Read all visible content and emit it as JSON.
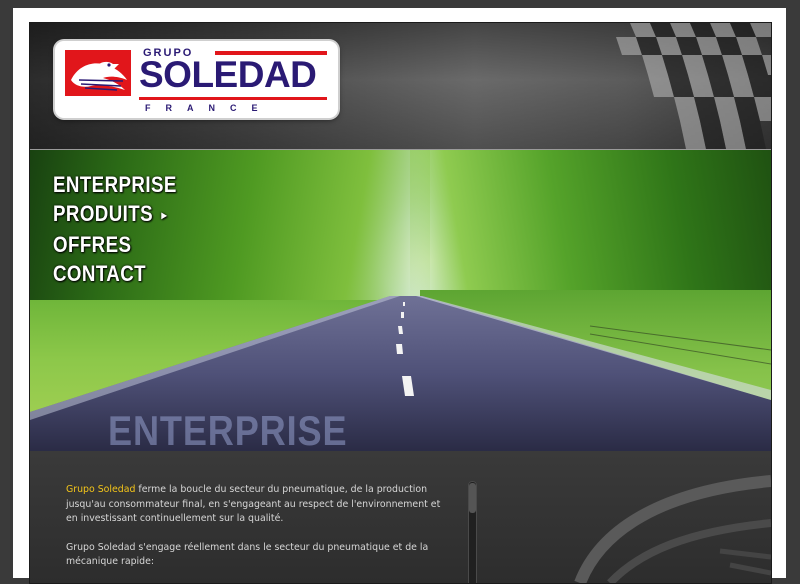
{
  "logo": {
    "grupo": "GRUPO",
    "name": "SOLEDAD",
    "country": "FRANCE",
    "colors": {
      "brand_blue": "#2a1a74",
      "brand_red": "#e1161b"
    }
  },
  "nav": {
    "items": [
      {
        "label": "ENTERPRISE"
      },
      {
        "label": "PRODUITS",
        "arrow": "▸"
      },
      {
        "label": "OFFRES"
      },
      {
        "label": "CONTACT"
      }
    ]
  },
  "hero": {
    "section_title": "ENTERPRISE"
  },
  "content": {
    "p1_highlight": "Grupo Soledad",
    "p1_rest": " ferme la boucle du secteur du pneumatique, de la production jusqu'au consommateur final, en s'engageant au respect de l'environnement et en investissant continuellement sur la qualité.",
    "p2": "Grupo Soledad s'engage réellement dans le secteur du pneumatique et de la mécanique rapide:",
    "highlight_color": "#f4c519"
  }
}
